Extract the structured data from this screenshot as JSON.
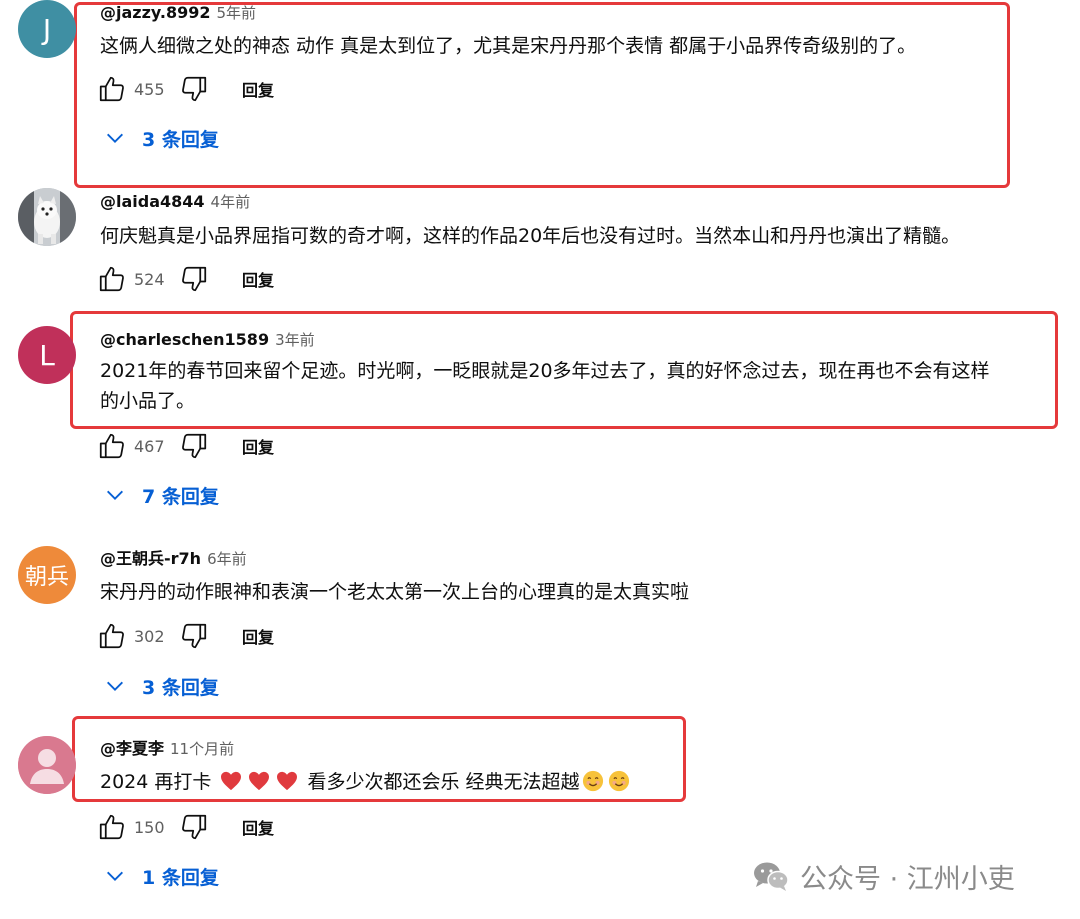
{
  "comments": [
    {
      "avatar_initial": "J",
      "avatar_color": "#3f8fa3",
      "author": "@jazzy.8992",
      "time": "5年前",
      "text": "这俩人细微之处的神态 动作 真是太到位了，尤其是宋丹丹那个表情 都属于小品界传奇级别的了。",
      "likes": "455",
      "reply_label": "回复",
      "replies_label": "3 条回复"
    },
    {
      "avatar_initial": "",
      "avatar_color": "#9aa0a6",
      "author": "@laida4844",
      "time": "4年前",
      "text": "何庆魁真是小品界屈指可数的奇才啊，这样的作品20年后也没有过时。当然本山和丹丹也演出了精髓。",
      "likes": "524",
      "reply_label": "回复",
      "replies_label": ""
    },
    {
      "avatar_initial": "L",
      "avatar_color": "#c0305a",
      "author": "@charleschen1589",
      "time": "3年前",
      "text_line1": "2021年的春节回来留个足迹。时光啊，一眨眼就是20多年过去了，真的好怀念过去，现在再也不会有这样",
      "text_line2": "的小品了。",
      "likes": "467",
      "reply_label": "回复",
      "replies_label": "7 条回复"
    },
    {
      "avatar_initial": "朝兵",
      "avatar_color": "#ee8a3a",
      "author": "@王朝兵-r7h",
      "time": "6年前",
      "text": "宋丹丹的动作眼神和表演一个老太太第一次上台的心理真的是太真实啦",
      "likes": "302",
      "reply_label": "回复",
      "replies_label": "3 条回复"
    },
    {
      "avatar_initial": "",
      "avatar_color": "#d9798f",
      "author": "@李夏李",
      "time": "11个月前",
      "text_a": "2024 再打卡",
      "text_b": "看多少次都还会乐 经典无法超越",
      "likes": "150",
      "reply_label": "回复",
      "replies_label": "1 条回复"
    }
  ],
  "watermark": "公众号 · 江州小吏",
  "colors": {
    "highlight": "#e5393b",
    "link": "#065fd4",
    "muted": "#606060"
  }
}
